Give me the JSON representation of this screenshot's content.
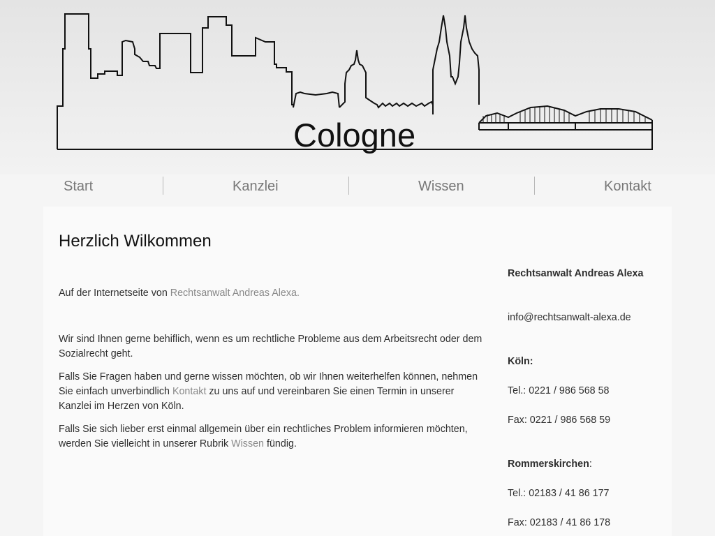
{
  "header": {
    "logo_text": "Cologne",
    "skyline_icon": "cologne-skyline-illustration"
  },
  "nav": {
    "items": [
      {
        "label": "Start"
      },
      {
        "label": "Kanzlei"
      },
      {
        "label": "Wissen"
      },
      {
        "label": "Kontakt"
      }
    ]
  },
  "main": {
    "title": "Herzlich Wilkommen",
    "intro_prefix": "Auf der Internetseite von ",
    "intro_link": "Rechtsanwalt Andreas Alexa.",
    "paragraph2": "Wir sind Ihnen gerne behiflich, wenn es um rechtliche Probleme aus dem Arbeitsrecht oder dem Sozialrecht geht.",
    "paragraph3_prefix": "Falls Sie Fragen haben und gerne wissen möchten, ob wir Ihnen weiterhelfen können, nehmen Sie einfach unverbindlich ",
    "paragraph3_link": "Kontakt",
    "paragraph3_suffix": " zu uns auf und vereinbaren Sie einen Termin in unserer Kanzlei im Herzen von Köln.",
    "paragraph4_prefix": "Falls Sie sich lieber erst einmal allgemein über ein rechtliches Problem informieren möchten, werden Sie vielleicht in unserer Rubrik ",
    "paragraph4_link": "Wissen",
    "paragraph4_suffix": " fündig."
  },
  "sidebar": {
    "name": "Rechtsanwalt Andreas Alexa",
    "email": "info@rechtsanwalt-alexa.de",
    "koeln_label": "Köln:",
    "koeln_tel": "Tel.: 0221 / 986 568 58",
    "koeln_fax": "Fax: 0221 / 986 568 59",
    "rommerskirchen_label": "Rommerskirchen",
    "rommerskirchen_colon": ":",
    "rommerskirchen_tel": "Tel.: 02183 / 41 86 177",
    "rommerskirchen_fax": "Fax: 02183 / 41 86 178"
  },
  "colors": {
    "link": "#888888",
    "nav_text": "#777777",
    "text": "#2e2e2e",
    "background": "#f5f5f5",
    "content_background": "#fafafa"
  }
}
